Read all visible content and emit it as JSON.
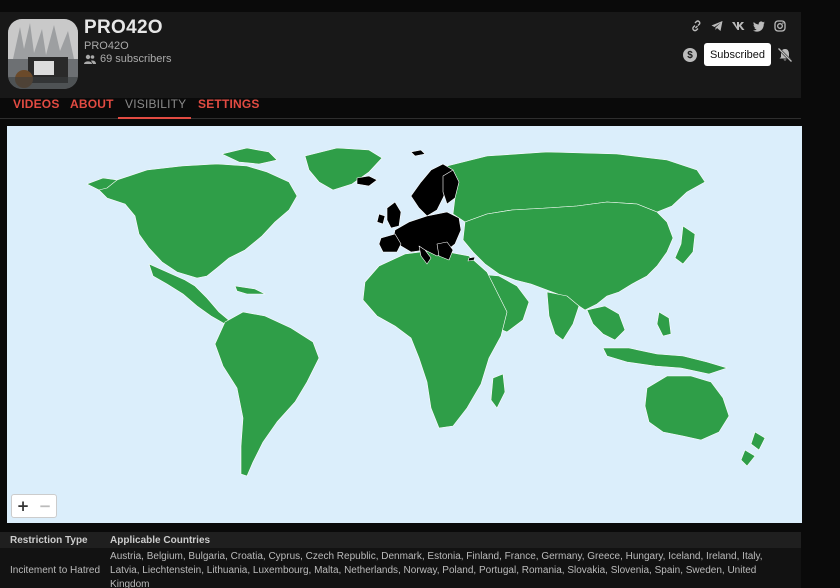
{
  "channel": {
    "name": "PRO42O",
    "handle": "PRO42O",
    "subscribers": "69 subscribers"
  },
  "social_icons": [
    "link-icon",
    "telegram-icon",
    "vk-icon",
    "twitter-icon",
    "instagram-icon"
  ],
  "actions": {
    "donate_symbol": "$",
    "subscribe_label": "Subscribed"
  },
  "tabs": [
    {
      "label": "VIDEOS",
      "active": false
    },
    {
      "label": "ABOUT",
      "active": false
    },
    {
      "label": "VISIBILITY",
      "active": true
    },
    {
      "label": "SETTINGS",
      "active": false
    }
  ],
  "map": {
    "ocean_color": "#dbeefb",
    "available_color": "#2f9e48",
    "restricted_color": "#000000",
    "zoom_in": "+",
    "zoom_out": "−"
  },
  "restrictions": {
    "headers": {
      "type": "Restriction Type",
      "countries": "Applicable Countries"
    },
    "rows": [
      {
        "type": "Incitement to Hatred",
        "countries": "Austria, Belgium, Bulgaria, Croatia, Cyprus, Czech Republic, Denmark, Estonia, Finland, France, Germany, Greece, Hungary, Iceland, Ireland, Italy, Latvia, Liechtenstein, Lithuania, Luxembourg, Malta, Netherlands, Norway, Poland, Portugal, Romania, Slovakia, Slovenia, Spain, Sweden, United Kingdom"
      }
    ]
  }
}
